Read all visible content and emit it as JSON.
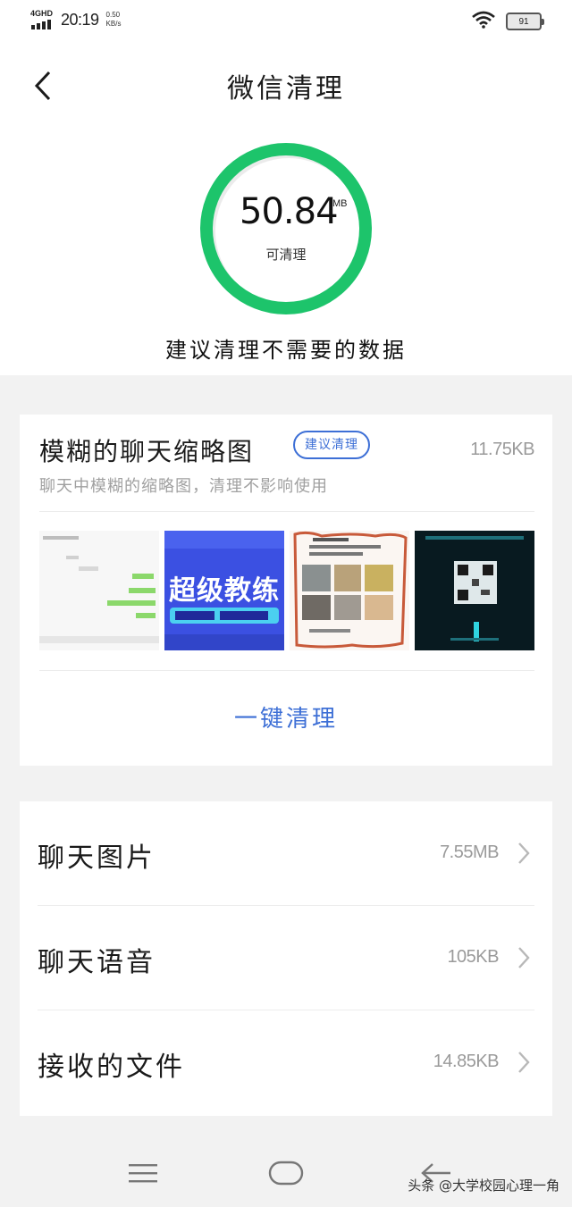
{
  "status_bar": {
    "network": "4GHD",
    "time": "20:19",
    "speed_value": "0.50",
    "speed_unit": "KB/s",
    "battery": "91",
    "icons": [
      "signal-icon",
      "wifi-icon",
      "battery-icon"
    ]
  },
  "header": {
    "title": "微信清理",
    "back_icon": "chevron-left-icon"
  },
  "summary": {
    "value": "50.84",
    "unit": "MB",
    "caption": "可清理",
    "suggestion": "建议清理不需要的数据",
    "ring_color": "#1dc46b"
  },
  "blurry_card": {
    "title": "模糊的聊天缩略图",
    "badge": "建议清理",
    "size": "11.75KB",
    "description": "聊天中模糊的缩略图，清理不影响使用",
    "thumbnails": [
      {
        "kind": "chat-screenshot"
      },
      {
        "kind": "blue-banner",
        "text": "超级教练"
      },
      {
        "kind": "photo-collage"
      },
      {
        "kind": "qr-poster"
      }
    ],
    "action": "一键清理",
    "accent": "#3d6fd6"
  },
  "categories": [
    {
      "label": "聊天图片",
      "size": "7.55MB"
    },
    {
      "label": "聊天语音",
      "size": "105KB"
    },
    {
      "label": "接收的文件",
      "size": "14.85KB"
    }
  ],
  "nav_bar": {
    "buttons": [
      "menu-icon",
      "home-icon",
      "back-arrow-icon"
    ]
  },
  "watermark": "头条 @大学校园心理一角"
}
